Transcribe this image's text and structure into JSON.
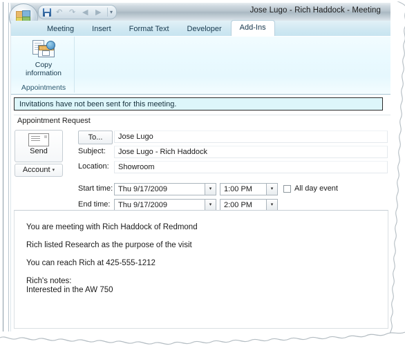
{
  "window": {
    "title": "Jose Lugo - Rich Haddock - Meeting"
  },
  "quick_access": {
    "save_label": "Save",
    "undo_label": "Undo",
    "redo_label": "Redo",
    "next_label": "Next",
    "previous_label": "Previous",
    "customize_label": "Customize Quick Access Toolbar",
    "chevron": "▾"
  },
  "office_button": {
    "label": "Office Button"
  },
  "ribbon": {
    "tabs": [
      {
        "label": "Meeting",
        "active": false
      },
      {
        "label": "Insert",
        "active": false
      },
      {
        "label": "Format Text",
        "active": false
      },
      {
        "label": "Developer",
        "active": false
      },
      {
        "label": "Add-Ins",
        "active": true
      }
    ],
    "groups": [
      {
        "name": "Appointments",
        "buttons": [
          {
            "label_line1": "Copy",
            "label_line2": "information",
            "icon": "copy-information-icon"
          }
        ]
      }
    ]
  },
  "info_bar": {
    "message": "Invitations have not been sent for this meeting."
  },
  "section": {
    "title": "Appointment Request"
  },
  "form": {
    "send_button": "Send",
    "account_button": "Account",
    "account_caret": "▾",
    "to_button": "To...",
    "to_value": "Jose Lugo",
    "subject_label": "Subject:",
    "subject_value": "Jose Lugo - Rich Haddock",
    "location_label": "Location:",
    "location_value": "Showroom",
    "start_time_label": "Start time:",
    "start_date_value": "Thu 9/17/2009",
    "start_time_value": "1:00 PM",
    "end_time_label": "End time:",
    "end_date_value": "Thu 9/17/2009",
    "end_time_value": "2:00 PM",
    "all_day_label": "All day event",
    "all_day_checked": false,
    "dropdown_caret": "▾"
  },
  "body": {
    "text": "You are meeting with Rich Haddock of Redmond\n\nRich listed Research as the purpose of the visit\n\nYou can reach Rich at 425-555-1212\n\nRich's notes:\nInterested in the AW 750"
  },
  "colors": {
    "titlebar_gradient_top": "#e8eef2",
    "titlebar_gradient_mid": "#a9b8c2",
    "tabstrip": "#d7ecf4",
    "ribbon_bg": "#eafaff",
    "info_bar_bg": "#ddf6fa",
    "info_bar_border": "#2b2b2b",
    "active_tab_bg": "#ffffff",
    "text": "#1a1a1a"
  }
}
